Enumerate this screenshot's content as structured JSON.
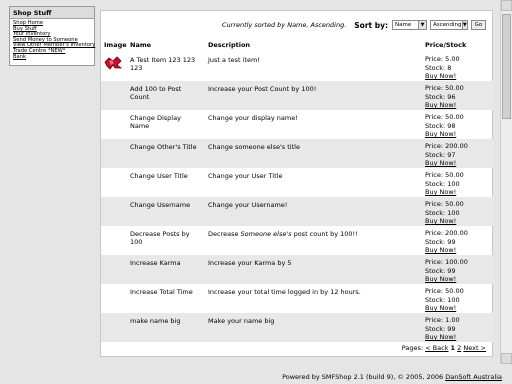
{
  "menu": {
    "title": "Shop Stuff",
    "links": [
      "Shop Home",
      "Buy Stuff",
      "Your Inventory",
      "Send Money to Someone",
      "View Other Member's Inventory",
      "Trade Centre *NEW*",
      "Bank"
    ]
  },
  "sort": {
    "status": "Currently sorted by Name, Ascending.",
    "label": "Sort by:",
    "field_value": "Name",
    "order_value": "Ascending",
    "go_label": "Go"
  },
  "table": {
    "headers": {
      "image": "Image",
      "name": "Name",
      "description": "Description",
      "price": "Price/Stock"
    },
    "rows": [
      {
        "name": "A Test Item 123 123 123",
        "description": "Just a test item!",
        "price": "Price: 5.00",
        "stock": "Stock: 8",
        "buy": "Buy Now!",
        "icon": "gem-icon"
      },
      {
        "name": "Add 100 to Post Count",
        "description": "Increase your Post Count by 100!",
        "price": "Price: 50.00",
        "stock": "Stock: 96",
        "buy": "Buy Now!"
      },
      {
        "name": "Change Display Name",
        "description": "Change your display name!",
        "price": "Price: 50.00",
        "stock": "Stock: 98",
        "buy": "Buy Now!"
      },
      {
        "name": "Change Other's Title",
        "description": "Change someone else's title",
        "price": "Price: 200.00",
        "stock": "Stock: 97",
        "buy": "Buy Now!"
      },
      {
        "name": "Change User Title",
        "description": "Change your User Title",
        "price": "Price: 50.00",
        "stock": "Stock: 100",
        "buy": "Buy Now!"
      },
      {
        "name": "Change Username",
        "description": "Change your Username!",
        "price": "Price: 50.00",
        "stock": "Stock: 100",
        "buy": "Buy Now!"
      },
      {
        "name": "Decrease Posts by 100",
        "description_pre": "Decrease ",
        "description_em": "Someone else's",
        "description_post": " post count by 100!!",
        "price": "Price: 200.00",
        "stock": "Stock: 99",
        "buy": "Buy Now!"
      },
      {
        "name": "Increase Karma",
        "description": "Increase your Karma by 5",
        "price": "Price: 100.00",
        "stock": "Stock: 99",
        "buy": "Buy Now!"
      },
      {
        "name": "Increase Total Time",
        "description": "Increase your total time logged in by 12 hours.",
        "price": "Price: 50.00",
        "stock": "Stock: 100",
        "buy": "Buy Now!"
      },
      {
        "name": "make name big",
        "description": "Make your name big",
        "price": "Price: 1.00",
        "stock": "Stock: 99",
        "buy": "Buy Now!"
      }
    ]
  },
  "pager": {
    "label": "Pages:",
    "back": "< Back",
    "page1": "1",
    "page2": "2",
    "next": "Next >"
  },
  "footer": {
    "text": "Powered by SMFShop 2.1 (build 9), © 2005, 2006",
    "link": "DanSoft Australia"
  },
  "colors": {
    "alt_row": "#e8e8e8",
    "menu_header": "#dcdcdc",
    "page_bg": "#e5e5e5"
  }
}
